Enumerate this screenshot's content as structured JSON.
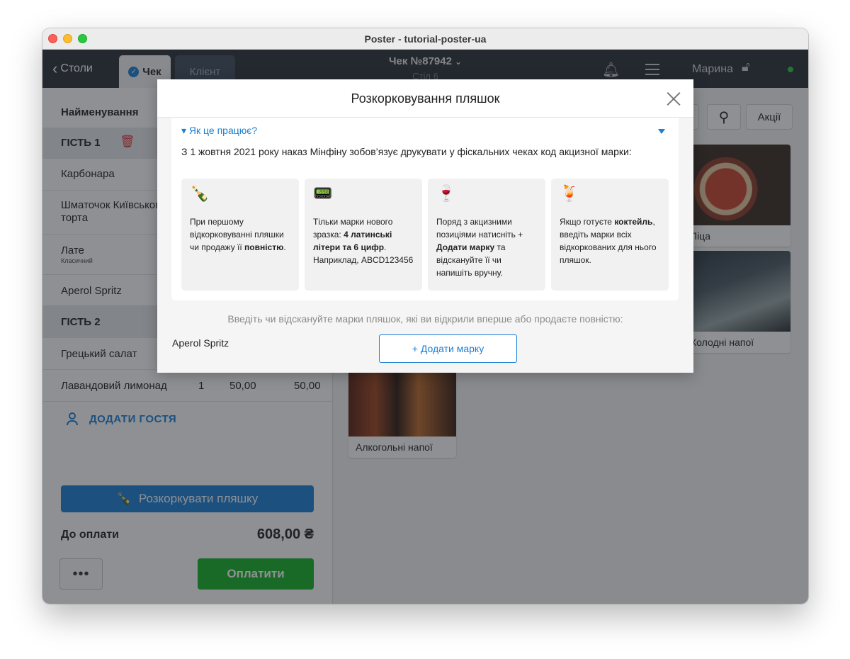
{
  "window": {
    "title": "Poster - tutorial-poster-ua"
  },
  "topbar": {
    "back_label": "Столи",
    "tab_check": "Чек",
    "tab_client": "Клієнт",
    "receipt_title": "Чек №87942",
    "receipt_sub": "Стіл 6",
    "user_name": "Марина"
  },
  "order": {
    "column_header": "Найменування",
    "rows": [
      {
        "name": "ГІСТЬ 1"
      },
      {
        "name": "Карбонара"
      },
      {
        "name": "Шматочок Київського торта"
      },
      {
        "name": "Лате",
        "sub": "Класичний"
      },
      {
        "name": "Aperol Spritz"
      },
      {
        "name": "ГІСТЬ 2"
      },
      {
        "name": "Грецький салат"
      },
      {
        "name": "Лавандовий лимонад",
        "qty": "1",
        "price": "50,00",
        "total": "50,00"
      }
    ],
    "add_guest": "ДОДАТИ ГОСТЯ",
    "uncork_button": "Розкоркувати пляшку",
    "pay_label": "До оплати",
    "pay_amount": "608,00 ₴",
    "more_button": "•••",
    "pay_button": "Оплатити"
  },
  "products": {
    "promo_button": "Акції",
    "tiles": [
      {
        "label": "Піца"
      },
      {
        "label": "Холодні напої"
      },
      {
        "label": "Алкогольні напої"
      }
    ]
  },
  "modal": {
    "title": "Розкорковування пляшок",
    "how_it_works": "Як це працює?",
    "description": "З 1 жовтня 2021 року наказ Мінфіну зобов’язує друкувати у фіскальних чеках код акцизної марки:",
    "cards": [
      {
        "emoji": "🍾",
        "parts": [
          "При першому відкорковуванні пляшки чи продажу її ",
          "повністю",
          "."
        ]
      },
      {
        "emoji": "📟",
        "parts": [
          "Тільки марки нового зразка: ",
          "4 латинські літери та 6 цифр",
          ". Наприклад, ABCD123456"
        ]
      },
      {
        "emoji": "🍷",
        "parts": [
          "Поряд з акцизними позиціями натисніть + ",
          "Додати марку",
          " та відскануйте її чи напишіть вручну."
        ]
      },
      {
        "emoji": "🍹",
        "parts": [
          "Якщо готуєте ",
          "коктейль",
          ", введіть марки всіх відкоркованих для нього пляшок."
        ]
      }
    ],
    "hint": "Введіть чи відскануйте марки пляшок, які ви відкрили вперше або продаєте повністю:",
    "item_name": "Aperol Spritz",
    "add_mark_button": "+ Додати марку"
  },
  "colors": {
    "accent": "#1b7fd5",
    "pay_green": "#16b227",
    "danger": "#e0363e",
    "topbar": "#2b3036"
  }
}
